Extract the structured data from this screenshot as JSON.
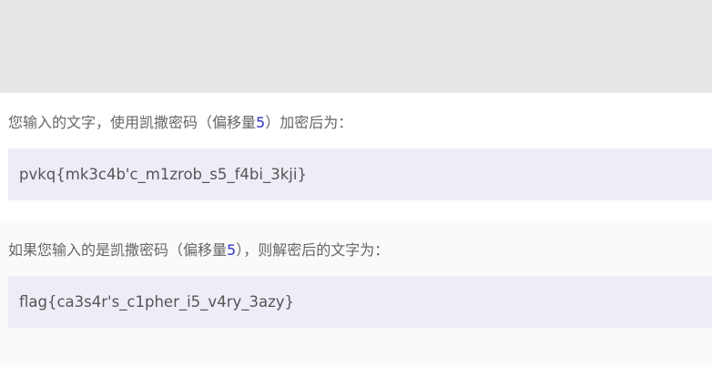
{
  "encrypt": {
    "label_before": "您输入的文字，使用凯撒密码（偏移量",
    "offset": "5",
    "label_after": "）加密后为：",
    "result": "pvkq{mk3c4b'c_m1zrob_s5_f4bi_3kji}"
  },
  "decrypt": {
    "label_before": "如果您输入的是凯撒密码（偏移量",
    "offset": "5",
    "label_after": "），则解密后的文字为：",
    "result": "flag{ca3s4r's_c1pher_i5_v4ry_3azy}"
  },
  "colors": {
    "header_band": "#e6e6e6",
    "result_box": "#ededf7",
    "offset_number": "#3333cc"
  }
}
